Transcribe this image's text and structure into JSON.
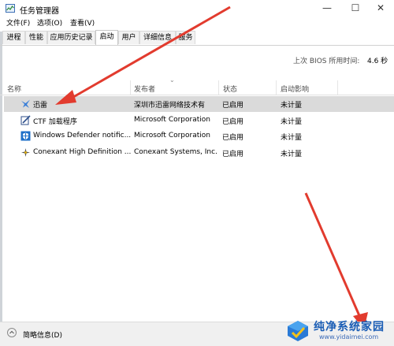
{
  "window": {
    "title": "任务管理器"
  },
  "menu": [
    "文件(F)",
    "选项(O)",
    "查看(V)"
  ],
  "tabs": [
    {
      "label": "进程"
    },
    {
      "label": "性能"
    },
    {
      "label": "应用历史记录"
    },
    {
      "label": "启动",
      "active": true
    },
    {
      "label": "用户"
    },
    {
      "label": "详细信息"
    },
    {
      "label": "服务"
    }
  ],
  "bios": {
    "label": "上次 BIOS 所用时间:",
    "value": "4.6 秒"
  },
  "columns": {
    "name": "名称",
    "publisher": "发布者",
    "status": "状态",
    "impact": "启动影响"
  },
  "rows": [
    {
      "name": "迅雷",
      "publisher": "深圳市迅雷网络技术有",
      "status": "已启用",
      "impact": "未计量",
      "icon": "thunder-icon",
      "selected": true
    },
    {
      "name": "CTF 加载程序",
      "publisher": "Microsoft Corporation",
      "status": "已启用",
      "impact": "未计量",
      "icon": "ctf-loader-icon"
    },
    {
      "name": "Windows Defender notific...",
      "publisher": "Microsoft Corporation",
      "status": "已启用",
      "impact": "未计量",
      "icon": "defender-icon"
    },
    {
      "name": "Conexant High Definition ...",
      "publisher": "Conexant Systems, Inc.",
      "status": "已启用",
      "impact": "未计量",
      "icon": "conexant-icon"
    }
  ],
  "footer": {
    "label": "简略信息(D)"
  },
  "watermark": {
    "name": "纯净系统家园",
    "url": "www.yidaimei.com"
  },
  "colors": {
    "arrow": "#e23b2e",
    "selected_row": "#dadada",
    "watermark": "#1a5db5"
  }
}
